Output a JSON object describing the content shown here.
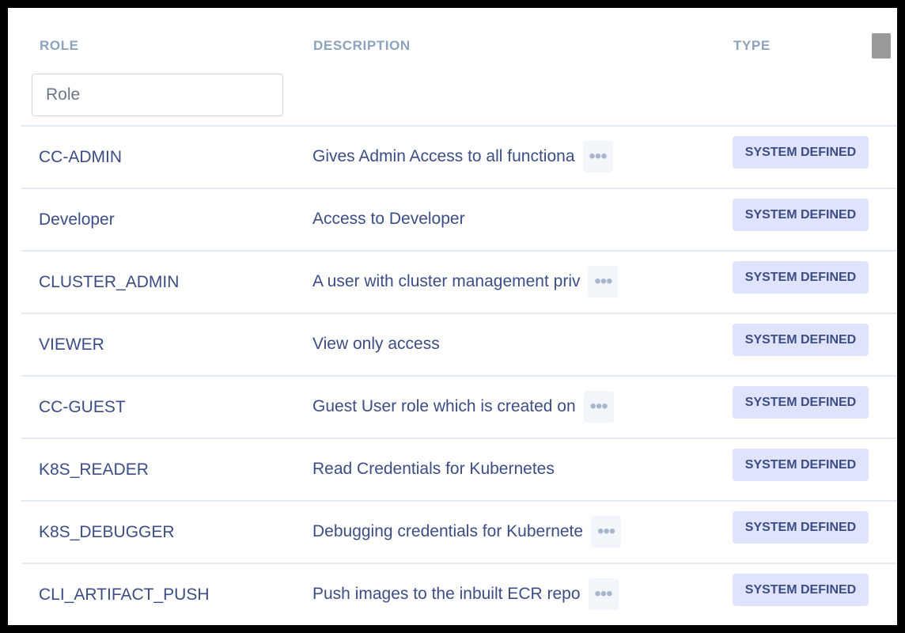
{
  "table": {
    "columns": {
      "role": "ROLE",
      "description": "DESCRIPTION",
      "type": "TYPE"
    },
    "filter": {
      "role_placeholder": "Role"
    },
    "rows": [
      {
        "role": "CC-ADMIN",
        "description": "Gives Admin Access to all functiona",
        "truncated": true,
        "type": "SYSTEM DEFINED"
      },
      {
        "role": "Developer",
        "description": "Access to Developer",
        "truncated": false,
        "type": "SYSTEM DEFINED"
      },
      {
        "role": "CLUSTER_ADMIN",
        "description": "A user with cluster management priv",
        "truncated": true,
        "type": "SYSTEM DEFINED"
      },
      {
        "role": "VIEWER",
        "description": "View only access",
        "truncated": false,
        "type": "SYSTEM DEFINED"
      },
      {
        "role": "CC-GUEST",
        "description": "Guest User role which is created on",
        "truncated": true,
        "type": "SYSTEM DEFINED"
      },
      {
        "role": "K8S_READER",
        "description": "Read Credentials for Kubernetes",
        "truncated": false,
        "type": "SYSTEM DEFINED"
      },
      {
        "role": "K8S_DEBUGGER",
        "description": "Debugging credentials for Kubernete",
        "truncated": true,
        "type": "SYSTEM DEFINED"
      },
      {
        "role": "CLI_ARTIFACT_PUSH",
        "description": "Push images to the inbuilt ECR repo",
        "truncated": true,
        "type": "SYSTEM DEFINED"
      }
    ],
    "more_icon": "ellipsis-icon",
    "colors": {
      "header_text": "#8da2bd",
      "body_text": "#3c4d86",
      "badge_bg": "#dfe3fb",
      "badge_text": "#3d4c85",
      "divider": "#e3eaf3"
    }
  }
}
